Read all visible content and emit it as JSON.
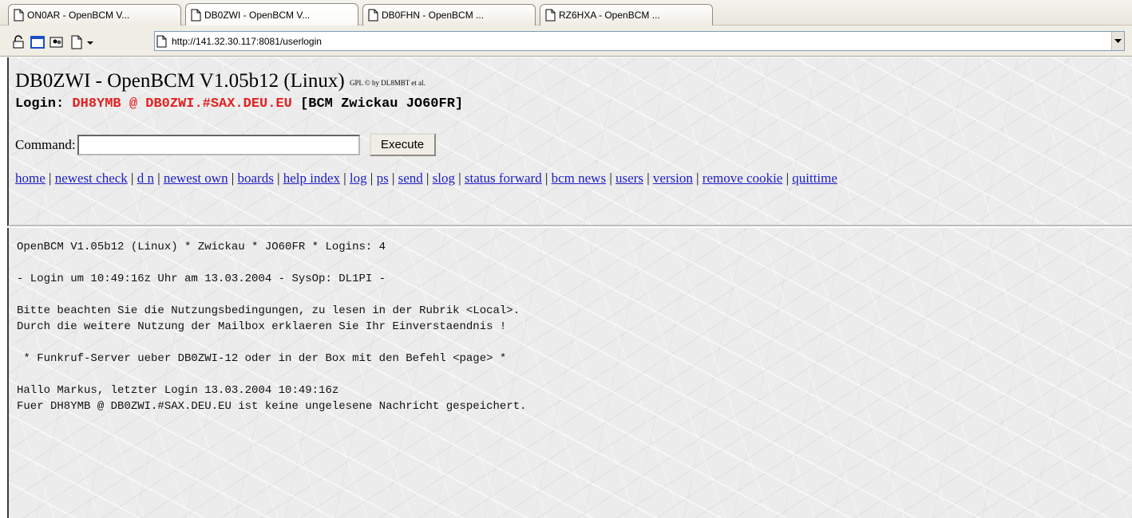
{
  "tabs": [
    {
      "label": "ON0AR - OpenBCM V...",
      "active": false
    },
    {
      "label": "DB0ZWI - OpenBCM V...",
      "active": true
    },
    {
      "label": "DB0FHN - OpenBCM ...",
      "active": false
    },
    {
      "label": "RZ6HXA - OpenBCM ...",
      "active": false
    }
  ],
  "toolbar": {
    "icons": [
      "lock-icon",
      "window-icon",
      "people-icon",
      "new-page-icon",
      "dropdown-arrow-icon"
    ],
    "url": "http://141.32.30.117:8081/userlogin"
  },
  "header": {
    "title": "DB0ZWI - OpenBCM V1.05b12 (Linux)",
    "gpl": "GPL © by DL8MBT et al.",
    "login_label": "Login:",
    "login_user": "DH8YMB @ DB0ZWI.#SAX.DEU.EU",
    "login_bbs": "[BCM Zwickau JO60FR]"
  },
  "command": {
    "label": "Command:",
    "value": "",
    "execute_label": "Execute"
  },
  "nav": [
    "home",
    "newest check",
    "d n",
    "newest own",
    "boards",
    "help index",
    "log",
    "ps",
    "send",
    "slog",
    "status forward",
    "bcm news",
    "users",
    "version",
    "remove cookie",
    "quittime"
  ],
  "terminal": {
    "lines": [
      "OpenBCM V1.05b12 (Linux) * Zwickau * JO60FR * Logins: 4",
      "",
      "- Login um 10:49:16z Uhr am 13.03.2004 - SysOp: DL1PI -",
      "",
      "Bitte beachten Sie die Nutzungsbedingungen, zu lesen in der Rubrik <Local>.",
      "Durch die weitere Nutzung der Mailbox erklaeren Sie Ihr Einverstaendnis !",
      "",
      " * Funkruf-Server ueber DB0ZWI-12 oder in der Box mit den Befehl <page> *",
      "",
      "Hallo Markus, letzter Login 13.03.2004 10:49:16z",
      "Fuer DH8YMB @ DB0ZWI.#SAX.DEU.EU ist keine ungelesene Nachricht gespeichert."
    ]
  },
  "colors": {
    "link": "#1c1cc4",
    "login_red": "#e32020"
  }
}
